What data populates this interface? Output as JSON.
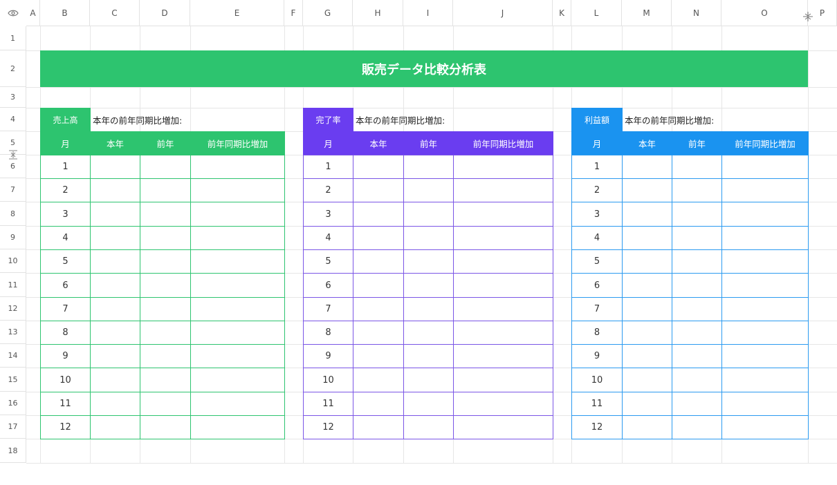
{
  "columns": [
    "A",
    "B",
    "C",
    "D",
    "E",
    "F",
    "G",
    "H",
    "I",
    "J",
    "K",
    "L",
    "M",
    "N",
    "O",
    "P"
  ],
  "rows": [
    "1",
    "2",
    "3",
    "4",
    "5",
    "6",
    "7",
    "8",
    "9",
    "10",
    "11",
    "12",
    "13",
    "14",
    "15",
    "16",
    "17",
    "18"
  ],
  "title": "販売データ比較分析表",
  "tables": [
    {
      "key": "sales",
      "label": "売上高",
      "note": "本年の前年同期比増加:",
      "color": "#2dc46f",
      "headers": [
        "月",
        "本年",
        "前年",
        "前年同期比増加"
      ],
      "months": [
        "1",
        "2",
        "3",
        "4",
        "5",
        "6",
        "7",
        "8",
        "9",
        "10",
        "11",
        "12"
      ]
    },
    {
      "key": "completion",
      "label": "完了率",
      "note": "本年の前年同期比増加:",
      "color": "#6a3df0",
      "headers": [
        "月",
        "本年",
        "前年",
        "前年同期比増加"
      ],
      "months": [
        "1",
        "2",
        "3",
        "4",
        "5",
        "6",
        "7",
        "8",
        "9",
        "10",
        "11",
        "12"
      ]
    },
    {
      "key": "profit",
      "label": "利益額",
      "note": "本年の前年同期比増加:",
      "color": "#1a93f0",
      "headers": [
        "月",
        "本年",
        "前年",
        "前年同期比増加"
      ],
      "months": [
        "1",
        "2",
        "3",
        "4",
        "5",
        "6",
        "7",
        "8",
        "9",
        "10",
        "11",
        "12"
      ]
    }
  ],
  "icons": {
    "view": "eye-icon",
    "freeze": "freeze-pane-icon"
  }
}
